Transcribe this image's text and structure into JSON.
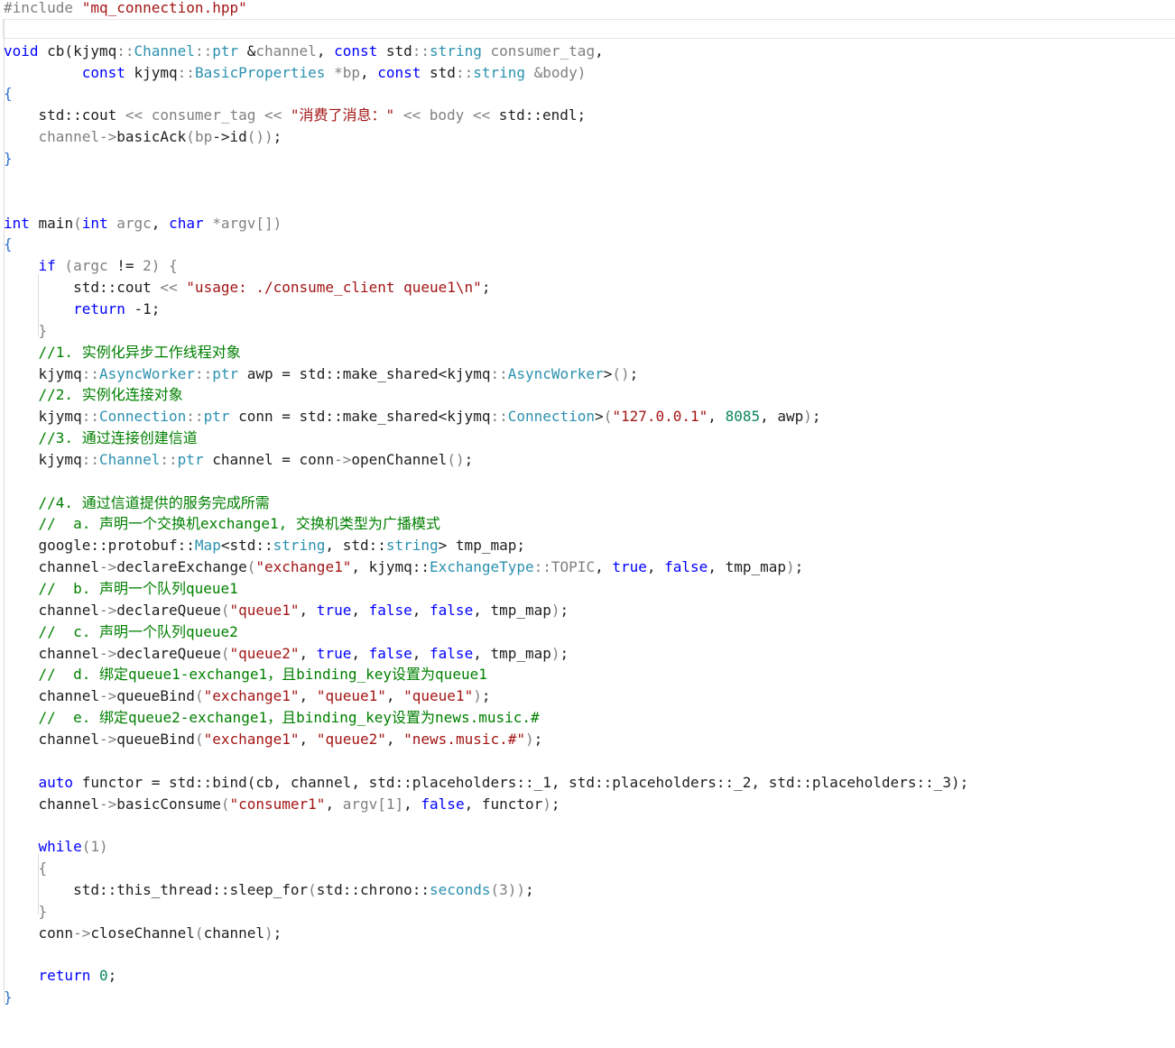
{
  "editor": {
    "language": "cpp",
    "colors": {
      "keyword": "#0000ff",
      "type": "#2b91af",
      "string": "#a31515",
      "comment": "#008000",
      "number": "#098658",
      "default": "#1e1e1e",
      "muted": "#808080",
      "background": "#ffffff"
    },
    "lines": [
      [
        [
          "pp",
          "#include "
        ],
        [
          "s",
          "\"mq_connection.hpp\""
        ]
      ],
      [],
      [
        [
          "k",
          "void"
        ],
        [
          "f",
          " cb("
        ],
        [
          "f",
          "kjymq"
        ],
        [
          "p",
          "::"
        ],
        [
          "t",
          "Channel"
        ],
        [
          "p",
          "::"
        ],
        [
          "t",
          "ptr"
        ],
        [
          "f",
          " &"
        ],
        [
          "v",
          "channel"
        ],
        [
          "f",
          ", "
        ],
        [
          "k",
          "const"
        ],
        [
          "f",
          " std"
        ],
        [
          "p",
          "::"
        ],
        [
          "t",
          "string"
        ],
        [
          "v",
          " consumer_tag"
        ],
        [
          "f",
          ","
        ]
      ],
      [
        [
          "f",
          "         "
        ],
        [
          "k",
          "const"
        ],
        [
          "f",
          " kjymq"
        ],
        [
          "p",
          "::"
        ],
        [
          "t",
          "BasicProperties"
        ],
        [
          "v",
          " *bp"
        ],
        [
          "f",
          ", "
        ],
        [
          "k",
          "const"
        ],
        [
          "f",
          " std"
        ],
        [
          "p",
          "::"
        ],
        [
          "t",
          "string"
        ],
        [
          "v",
          " &body"
        ],
        [
          "p",
          ")"
        ]
      ],
      [
        [
          "b",
          "{"
        ]
      ],
      [
        [
          "f",
          "    std::cout "
        ],
        [
          "p",
          "<<"
        ],
        [
          "v",
          " consumer_tag"
        ],
        [
          "f",
          " "
        ],
        [
          "p",
          "<<"
        ],
        [
          "f",
          " "
        ],
        [
          "s",
          "\"消费了消息：\""
        ],
        [
          "f",
          " "
        ],
        [
          "p",
          "<<"
        ],
        [
          "v",
          " body"
        ],
        [
          "f",
          " "
        ],
        [
          "p",
          "<<"
        ],
        [
          "f",
          " std::endl;"
        ]
      ],
      [
        [
          "v",
          "    channel"
        ],
        [
          "p",
          "->"
        ],
        [
          "f",
          "basicAck"
        ],
        [
          "p",
          "("
        ],
        [
          "v",
          "bp"
        ],
        [
          "f",
          "->id"
        ],
        [
          "p",
          "())"
        ],
        [
          "f",
          ";"
        ]
      ],
      [
        [
          "b",
          "}"
        ]
      ],
      [],
      [],
      [
        [
          "k",
          "int"
        ],
        [
          "f",
          " main"
        ],
        [
          "p",
          "("
        ],
        [
          "k",
          "int"
        ],
        [
          "v",
          " argc"
        ],
        [
          "f",
          ", "
        ],
        [
          "k",
          "char"
        ],
        [
          "v",
          " *argv"
        ],
        [
          "p",
          "[])"
        ]
      ],
      [
        [
          "b",
          "{"
        ]
      ],
      [
        [
          "k",
          "    if"
        ],
        [
          "p",
          " ("
        ],
        [
          "v",
          "argc"
        ],
        [
          "f",
          " != "
        ],
        [
          "p",
          "2) {"
        ]
      ],
      [
        [
          "f",
          "        std::cout "
        ],
        [
          "p",
          "<<"
        ],
        [
          "f",
          " "
        ],
        [
          "s",
          "\"usage: ./consume_client queue1\\n\""
        ],
        [
          "f",
          ";"
        ]
      ],
      [
        [
          "k",
          "        return"
        ],
        [
          "f",
          " -1;"
        ]
      ],
      [
        [
          "p",
          "    }"
        ]
      ],
      [
        [
          "c",
          "    //1. 实例化异步工作线程对象"
        ]
      ],
      [
        [
          "f",
          "    kjymq"
        ],
        [
          "p",
          "::"
        ],
        [
          "t",
          "AsyncWorker"
        ],
        [
          "p",
          "::"
        ],
        [
          "t",
          "ptr"
        ],
        [
          "f",
          " awp = std::make_shared<kjymq"
        ],
        [
          "p",
          "::"
        ],
        [
          "t",
          "AsyncWorker"
        ],
        [
          "f",
          ">"
        ],
        [
          "p",
          "()"
        ],
        [
          "f",
          ";"
        ]
      ],
      [
        [
          "c",
          "    //2. 实例化连接对象"
        ]
      ],
      [
        [
          "f",
          "    kjymq"
        ],
        [
          "p",
          "::"
        ],
        [
          "t",
          "Connection"
        ],
        [
          "p",
          "::"
        ],
        [
          "t",
          "ptr"
        ],
        [
          "f",
          " conn = std::make_shared<kjymq"
        ],
        [
          "p",
          "::"
        ],
        [
          "t",
          "Connection"
        ],
        [
          "f",
          ">"
        ],
        [
          "p",
          "("
        ],
        [
          "s",
          "\"127.0.0.1\""
        ],
        [
          "f",
          ", "
        ],
        [
          "n",
          "8085"
        ],
        [
          "f",
          ", awp"
        ],
        [
          "p",
          ")"
        ],
        [
          "f",
          ";"
        ]
      ],
      [
        [
          "c",
          "    //3. 通过连接创建信道"
        ]
      ],
      [
        [
          "f",
          "    kjymq"
        ],
        [
          "p",
          "::"
        ],
        [
          "t",
          "Channel"
        ],
        [
          "p",
          "::"
        ],
        [
          "t",
          "ptr"
        ],
        [
          "f",
          " channel = conn"
        ],
        [
          "p",
          "->"
        ],
        [
          "f",
          "openChannel"
        ],
        [
          "p",
          "()"
        ],
        [
          "f",
          ";"
        ]
      ],
      [],
      [
        [
          "c",
          "    //4. 通过信道提供的服务完成所需"
        ]
      ],
      [
        [
          "c",
          "    //  a. 声明一个交换机exchange1, 交换机类型为广播模式"
        ]
      ],
      [
        [
          "f",
          "    google::protobuf::"
        ],
        [
          "t",
          "Map"
        ],
        [
          "f",
          "<std::"
        ],
        [
          "t",
          "string"
        ],
        [
          "f",
          ", std::"
        ],
        [
          "t",
          "string"
        ],
        [
          "f",
          "> tmp_map;"
        ]
      ],
      [
        [
          "f",
          "    channel"
        ],
        [
          "p",
          "->"
        ],
        [
          "f",
          "declareExchange"
        ],
        [
          "p",
          "("
        ],
        [
          "s",
          "\"exchange1\""
        ],
        [
          "f",
          ", kjymq::"
        ],
        [
          "t",
          "ExchangeType"
        ],
        [
          "p",
          "::"
        ],
        [
          "v",
          "TOPIC"
        ],
        [
          "f",
          ", "
        ],
        [
          "k",
          "true"
        ],
        [
          "f",
          ", "
        ],
        [
          "k",
          "false"
        ],
        [
          "f",
          ", tmp_map"
        ],
        [
          "p",
          ")"
        ],
        [
          "f",
          ";"
        ]
      ],
      [
        [
          "c",
          "    //  b. 声明一个队列queue1"
        ]
      ],
      [
        [
          "f",
          "    channel"
        ],
        [
          "p",
          "->"
        ],
        [
          "f",
          "declareQueue"
        ],
        [
          "p",
          "("
        ],
        [
          "s",
          "\"queue1\""
        ],
        [
          "f",
          ", "
        ],
        [
          "k",
          "true"
        ],
        [
          "f",
          ", "
        ],
        [
          "k",
          "false"
        ],
        [
          "f",
          ", "
        ],
        [
          "k",
          "false"
        ],
        [
          "f",
          ", tmp_map"
        ],
        [
          "p",
          ")"
        ],
        [
          "f",
          ";"
        ]
      ],
      [
        [
          "c",
          "    //  c. 声明一个队列queue2"
        ]
      ],
      [
        [
          "f",
          "    channel"
        ],
        [
          "p",
          "->"
        ],
        [
          "f",
          "declareQueue"
        ],
        [
          "p",
          "("
        ],
        [
          "s",
          "\"queue2\""
        ],
        [
          "f",
          ", "
        ],
        [
          "k",
          "true"
        ],
        [
          "f",
          ", "
        ],
        [
          "k",
          "false"
        ],
        [
          "f",
          ", "
        ],
        [
          "k",
          "false"
        ],
        [
          "f",
          ", tmp_map"
        ],
        [
          "p",
          ")"
        ],
        [
          "f",
          ";"
        ]
      ],
      [
        [
          "c",
          "    //  d. 绑定queue1-exchange1，且binding_key设置为queue1"
        ]
      ],
      [
        [
          "f",
          "    channel"
        ],
        [
          "p",
          "->"
        ],
        [
          "f",
          "queueBind"
        ],
        [
          "p",
          "("
        ],
        [
          "s",
          "\"exchange1\""
        ],
        [
          "f",
          ", "
        ],
        [
          "s",
          "\"queue1\""
        ],
        [
          "f",
          ", "
        ],
        [
          "s",
          "\"queue1\""
        ],
        [
          "p",
          ")"
        ],
        [
          "f",
          ";"
        ]
      ],
      [
        [
          "c",
          "    //  e. 绑定queue2-exchange1，且binding_key设置为news.music.#"
        ]
      ],
      [
        [
          "f",
          "    channel"
        ],
        [
          "p",
          "->"
        ],
        [
          "f",
          "queueBind"
        ],
        [
          "p",
          "("
        ],
        [
          "s",
          "\"exchange1\""
        ],
        [
          "f",
          ", "
        ],
        [
          "s",
          "\"queue2\""
        ],
        [
          "f",
          ", "
        ],
        [
          "s",
          "\"news.music.#\""
        ],
        [
          "p",
          ")"
        ],
        [
          "f",
          ";"
        ]
      ],
      [],
      [
        [
          "k",
          "    auto"
        ],
        [
          "f",
          " functor = std::bind(cb, channel, std::placeholders::_1, std::placeholders::_2, std::placeholders::_3);"
        ]
      ],
      [
        [
          "f",
          "    channel"
        ],
        [
          "p",
          "->"
        ],
        [
          "f",
          "basicConsume"
        ],
        [
          "p",
          "("
        ],
        [
          "s",
          "\"consumer1\""
        ],
        [
          "f",
          ", "
        ],
        [
          "v",
          "argv"
        ],
        [
          "p",
          "[1]"
        ],
        [
          "f",
          ", "
        ],
        [
          "k",
          "false"
        ],
        [
          "f",
          ", functor"
        ],
        [
          "p",
          ")"
        ],
        [
          "f",
          ";"
        ]
      ],
      [],
      [
        [
          "k",
          "    while"
        ],
        [
          "p",
          "(1)"
        ]
      ],
      [
        [
          "p",
          "    {"
        ]
      ],
      [
        [
          "f",
          "        std::this_thread::sleep_for"
        ],
        [
          "p",
          "("
        ],
        [
          "f",
          "std::chrono::"
        ],
        [
          "t",
          "seconds"
        ],
        [
          "p",
          "(3))"
        ],
        [
          "f",
          ";"
        ]
      ],
      [
        [
          "p",
          "    }"
        ]
      ],
      [
        [
          "f",
          "    conn"
        ],
        [
          "p",
          "->"
        ],
        [
          "f",
          "closeChannel"
        ],
        [
          "p",
          "("
        ],
        [
          "f",
          "channel"
        ],
        [
          "p",
          ")"
        ],
        [
          "f",
          ";"
        ]
      ],
      [],
      [
        [
          "k",
          "    return"
        ],
        [
          "n",
          " 0"
        ],
        [
          "f",
          ";"
        ]
      ],
      [
        [
          "b",
          "}"
        ]
      ]
    ]
  }
}
